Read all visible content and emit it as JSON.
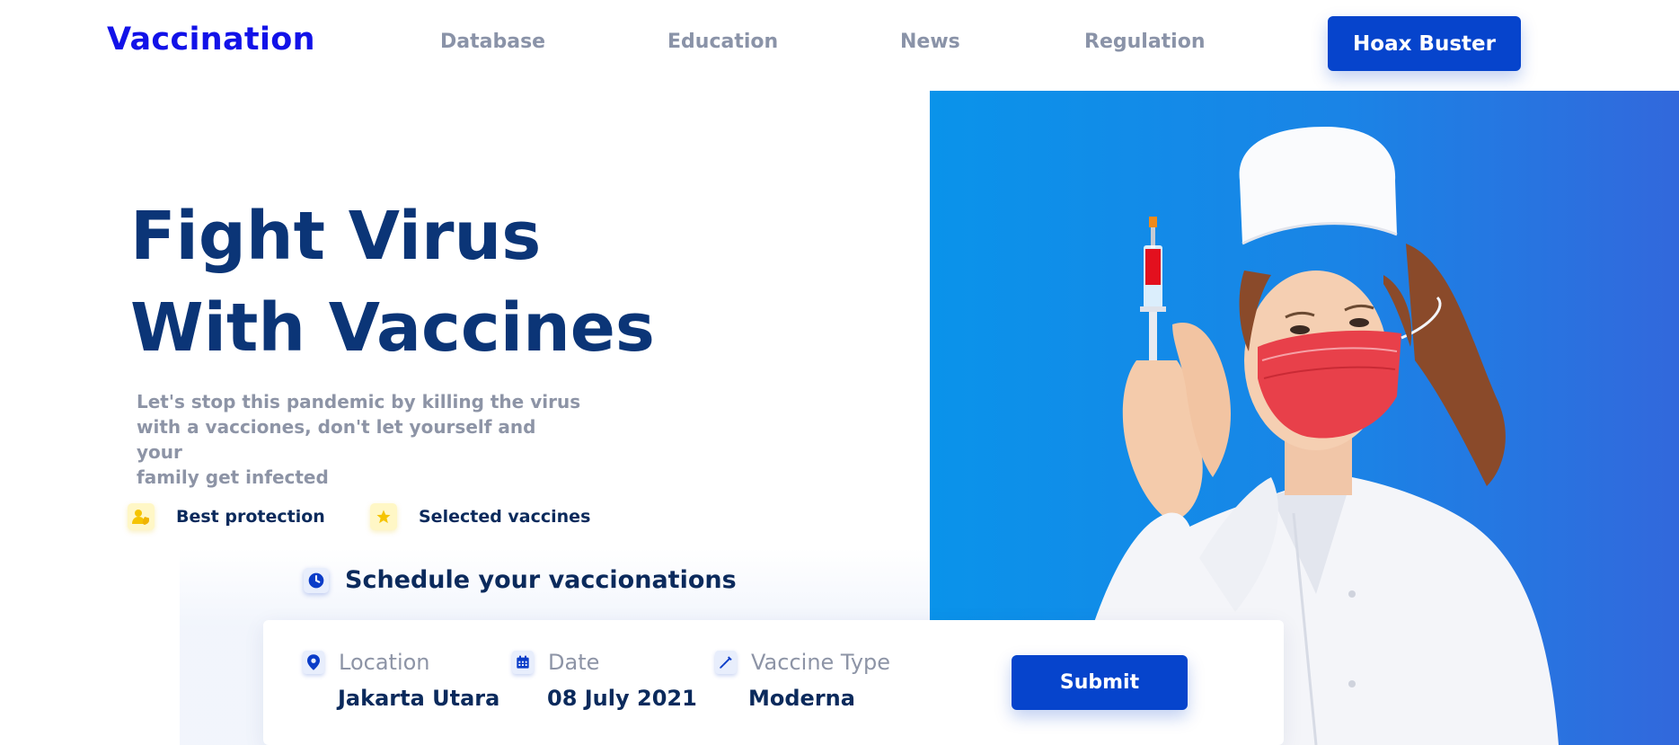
{
  "header": {
    "logo": "Vaccination",
    "nav": [
      "Database",
      "Education",
      "News",
      "Regulation"
    ],
    "cta": "Hoax Buster"
  },
  "hero": {
    "headline_line1": "Fight Virus",
    "headline_line2": "With Vaccines",
    "subtext_line1": "Let's stop this pandemic by killing the virus",
    "subtext_line2": "with a vacciones, don't let yourself and your",
    "subtext_line3": "family get infected",
    "features": [
      {
        "label": "Best protection",
        "icon": "user-shield-icon"
      },
      {
        "label": "Selected vaccines",
        "icon": "star-icon"
      }
    ]
  },
  "schedule": {
    "title": "Schedule your vaccionations",
    "fields": [
      {
        "label": "Location",
        "value": "Jakarta Utara",
        "icon": "location-pin-icon"
      },
      {
        "label": "Date",
        "value": "08 July 2021",
        "icon": "calendar-icon"
      },
      {
        "label": "Vaccine Type",
        "value": "Moderna",
        "icon": "syringe-icon"
      }
    ],
    "submit": "Submit"
  },
  "colors": {
    "brand": "#1212e8",
    "primary_button": "#0644cc",
    "heading": "#0b3577",
    "muted_text": "#8d94a6",
    "hero_bg_start": "#0a93ea",
    "hero_bg_end": "#3268dc",
    "feature_icon_bg": "#fff7c6"
  }
}
